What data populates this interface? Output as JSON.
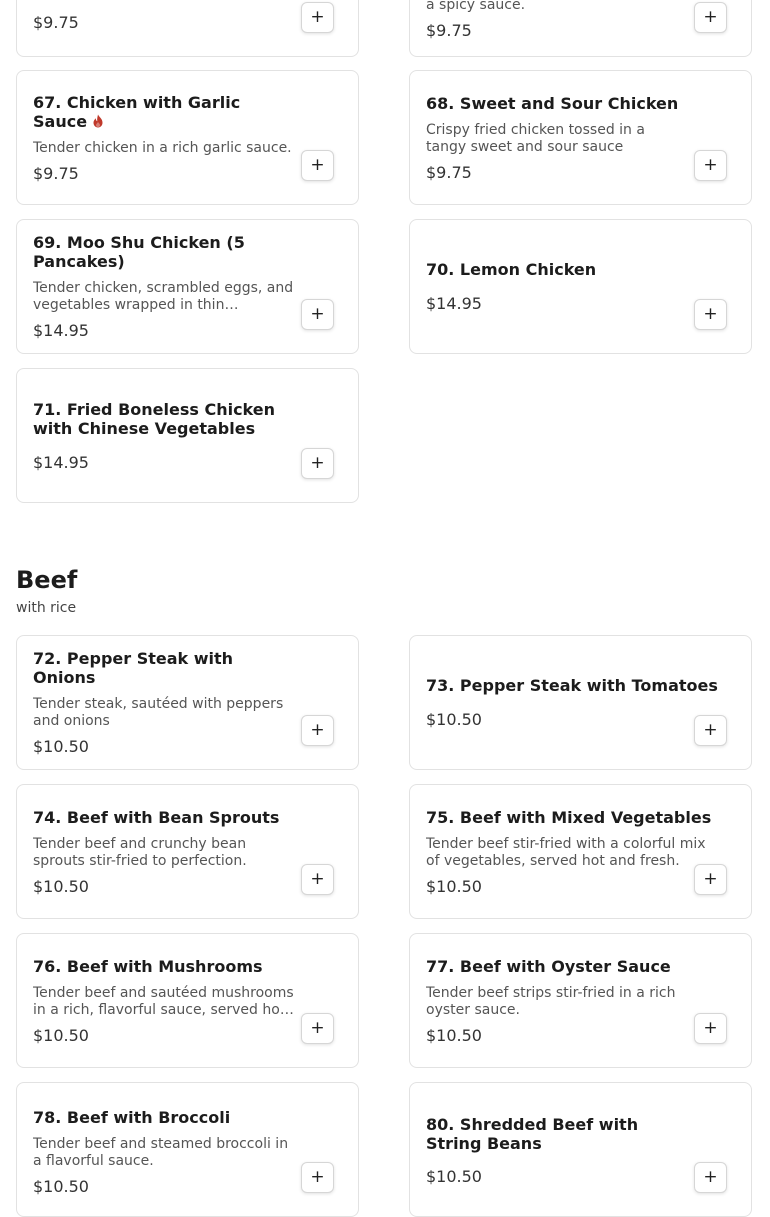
{
  "chicken_partial": [
    {
      "price": "$9.75"
    },
    {
      "desc_tail": "a spicy sauce.",
      "price": "$9.75"
    }
  ],
  "chicken_items": [
    {
      "title": "67. Chicken with Garlic Sauce",
      "spicy": true,
      "desc": "Tender chicken in a rich garlic sauce.",
      "price": "$9.75"
    },
    {
      "title": "68. Sweet and Sour Chicken",
      "desc": "Crispy fried chicken tossed in a tangy sweet and sour sauce",
      "price": "$9.75"
    },
    {
      "title": "69. Moo Shu Chicken (5 Pancakes)",
      "desc": "Tender chicken, scrambled eggs, and vegetables wrapped in thin pancakes.",
      "price": "$14.95"
    },
    {
      "title": "70. Lemon Chicken",
      "desc": "",
      "price": "$14.95"
    },
    {
      "title": "71. Fried Boneless Chicken with Chinese Vegetables",
      "desc": "",
      "price": "$14.95"
    }
  ],
  "beef_section": {
    "title": "Beef",
    "subtitle": "with rice"
  },
  "beef_items": [
    {
      "title": "72. Pepper Steak with Onions",
      "desc": "Tender steak, sautéed with peppers and onions",
      "price": "$10.50"
    },
    {
      "title": "73. Pepper Steak with Tomatoes",
      "desc": "",
      "price": "$10.50"
    },
    {
      "title": "74. Beef with Bean Sprouts",
      "desc": "Tender beef and crunchy bean sprouts stir-fried to perfection.",
      "price": "$10.50"
    },
    {
      "title": "75. Beef with Mixed Vegetables",
      "desc": "Tender beef stir-fried with a colorful mix of vegetables, served hot and fresh.",
      "price": "$10.50"
    },
    {
      "title": "76. Beef with Mushrooms",
      "desc": "Tender beef and sautéed mushrooms in a rich, flavorful sauce, served hot and fresh.",
      "price": "$10.50"
    },
    {
      "title": "77. Beef with Oyster Sauce",
      "desc": "Tender beef strips stir-fried in a rich oyster sauce.",
      "price": "$10.50"
    },
    {
      "title": "78. Beef with Broccoli",
      "desc": "Tender beef and steamed broccoli in a flavorful sauce.",
      "price": "$10.50"
    },
    {
      "title": "80. Shredded Beef with String Beans",
      "desc": "",
      "price": "$10.50"
    }
  ],
  "add_button_label": "+",
  "icons": {
    "spicy": "flame-icon",
    "add": "plus-icon"
  },
  "colors": {
    "spicy": "#c0392b",
    "border": "#e2e2e2",
    "text": "#1c1c1c"
  }
}
